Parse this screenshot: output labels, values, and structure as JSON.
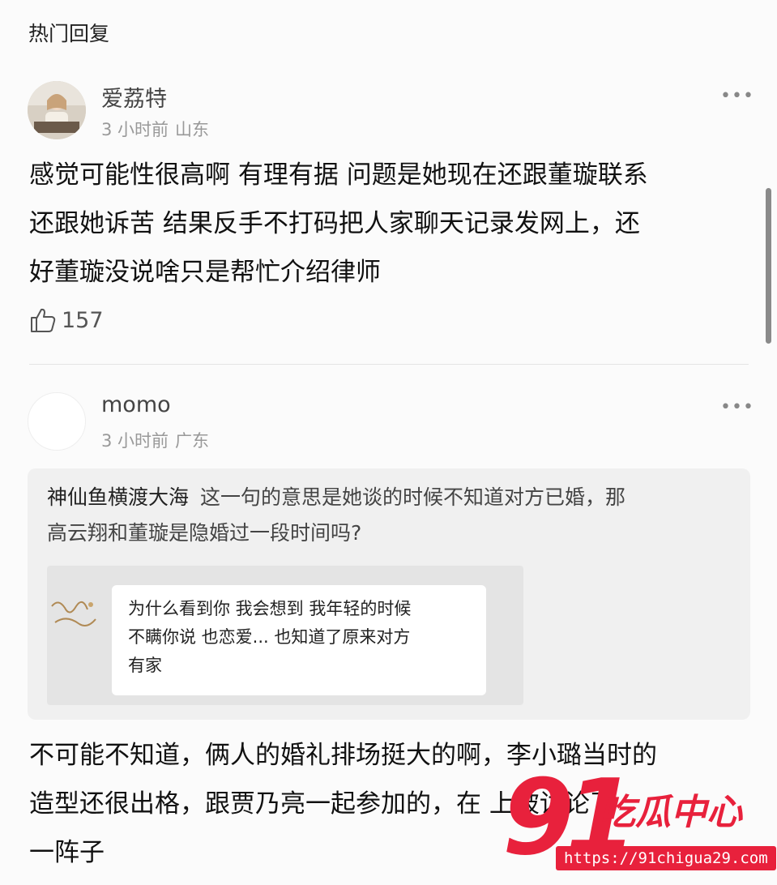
{
  "header": {
    "title": "热门回复"
  },
  "comments": [
    {
      "username": "爱荔特",
      "time": "3 小时前",
      "location": "山东",
      "text_lines": [
        "感觉可能性很高啊 有理有据 问题是她现在还跟董璇联系",
        "还跟她诉苦 结果反手不打码把人家聊天记录发网上，还",
        "好董璇没说啥只是帮忙介绍律师"
      ],
      "likes": "157",
      "more": "•••"
    },
    {
      "username": "momo",
      "time": "3 小时前",
      "location": "广东",
      "more": "•••",
      "quote": {
        "user": "神仙鱼横渡大海",
        "text_line1": "这一句的意思是她谈的时候不知道对方已婚，那",
        "text_line2": "高云翔和董璇是隐婚过一段时间吗?",
        "image_text": [
          "为什么看到你 我会想到 我年轻的时候",
          "不瞒你说 也恋爱... 也知道了原来对方",
          "有家"
        ]
      },
      "text_lines": [
        "不可能不知道，俩人的婚礼排场挺大的啊，李小璐当时的",
        "造型还很出格，跟贾乃亮一起参加的，在          上被讨论了",
        "一阵子"
      ]
    }
  ],
  "watermark": {
    "number": "91",
    "name": "吃瓜中心",
    "url": "https://91chigua29.com"
  },
  "icons": {
    "like": "thumbs-up-icon",
    "more": "more-dots-icon"
  },
  "colors": {
    "watermark": "#e8213c",
    "background": "#fbfbfb"
  }
}
